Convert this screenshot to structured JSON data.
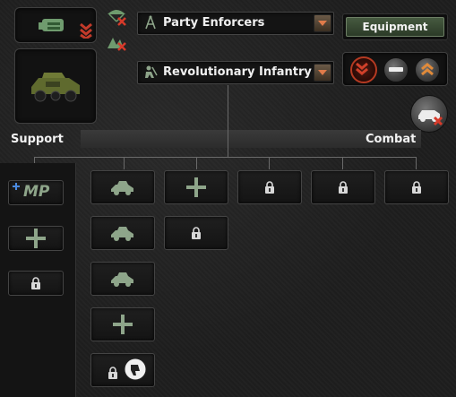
{
  "header": {
    "culture_dropdown": {
      "label": "Party Enforcers",
      "icon": "compass-icon"
    },
    "template_dropdown": {
      "label": "Revolutionary Infantry",
      "icon": "soldier-icon"
    },
    "equipment_button": "Equipment"
  },
  "sections": {
    "support_label": "Support",
    "combat_label": "Combat"
  },
  "support_slots": [
    {
      "kind": "military-police",
      "text": "MP"
    },
    {
      "kind": "add"
    },
    {
      "kind": "locked"
    }
  ],
  "combat_columns": [
    [
      "armored-car",
      "armored-car",
      "armored-car",
      "add",
      "locked-special"
    ],
    [
      "add",
      "locked"
    ],
    [
      "locked"
    ],
    [
      "locked"
    ],
    [
      "locked"
    ]
  ],
  "colors": {
    "accent_green": "#8ea58a",
    "chevron_red": "#c23a2a",
    "chevron_orange": "#e08a3a"
  }
}
